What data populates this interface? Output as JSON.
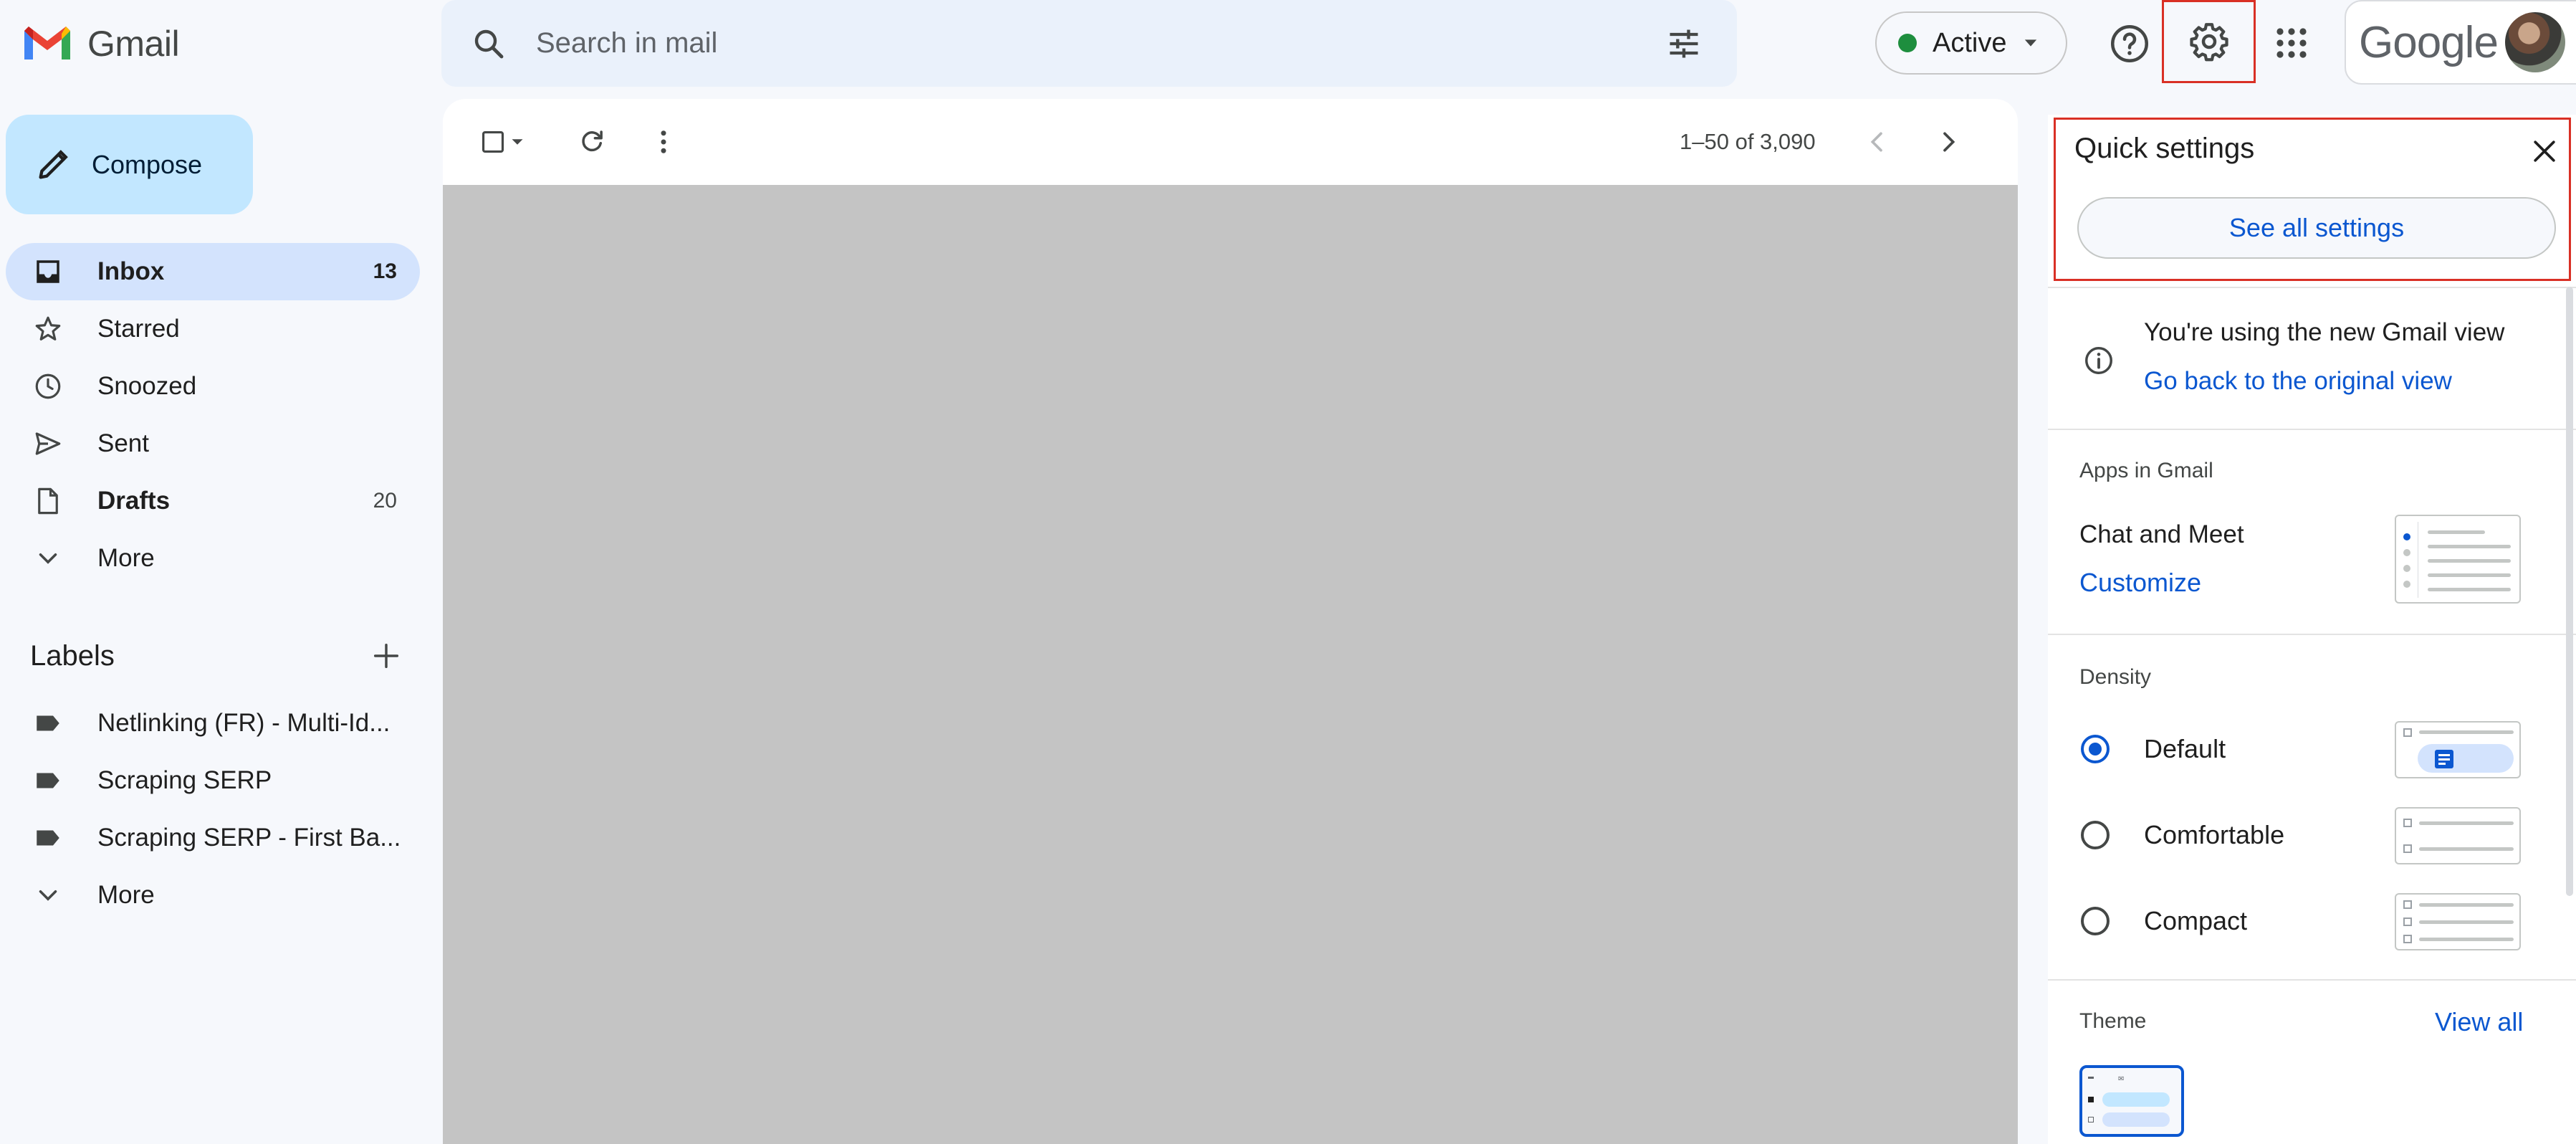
{
  "header": {
    "app_name": "Gmail",
    "search_placeholder": "Search in mail",
    "status_label": "Active",
    "account_brand": "Google"
  },
  "sidebar": {
    "compose_label": "Compose",
    "items": [
      {
        "label": "Inbox",
        "count": "13"
      },
      {
        "label": "Starred",
        "count": ""
      },
      {
        "label": "Snoozed",
        "count": ""
      },
      {
        "label": "Sent",
        "count": ""
      },
      {
        "label": "Drafts",
        "count": "20"
      },
      {
        "label": "More",
        "count": ""
      }
    ],
    "labels_heading": "Labels",
    "labels": [
      {
        "label": "Netlinking (FR) - Multi-Id..."
      },
      {
        "label": "Scraping SERP"
      },
      {
        "label": "Scraping SERP - First Ba..."
      }
    ],
    "labels_more": "More"
  },
  "toolbar": {
    "pagination": "1–50 of 3,090"
  },
  "quick_settings": {
    "title": "Quick settings",
    "see_all": "See all settings",
    "view_notice": "You're using the new Gmail view",
    "view_link": "Go back to the original view",
    "apps_heading": "Apps in Gmail",
    "chat_meet": "Chat and Meet",
    "customize": "Customize",
    "density_heading": "Density",
    "density_options": [
      {
        "label": "Default",
        "selected": true
      },
      {
        "label": "Comfortable",
        "selected": false
      },
      {
        "label": "Compact",
        "selected": false
      }
    ],
    "theme_heading": "Theme",
    "view_all": "View all"
  },
  "colors": {
    "accent": "#0b57d0",
    "highlight_border": "#d93025",
    "compose_bg": "#c2e7ff",
    "active_nav_bg": "#d3e3fd",
    "status_dot": "#1e8e3e"
  }
}
